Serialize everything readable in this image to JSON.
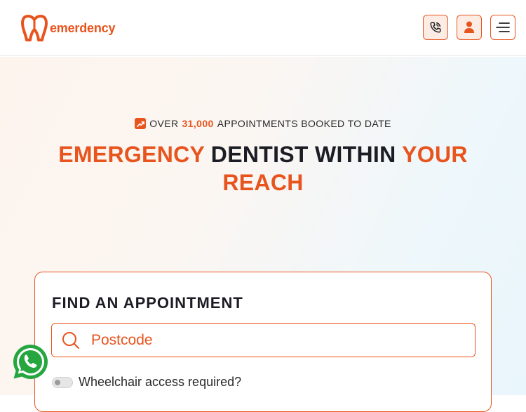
{
  "brand": {
    "name": "emerdency",
    "accent": "#e8541e"
  },
  "header": {
    "buttons": [
      {
        "icon": "phone-icon"
      },
      {
        "icon": "user-icon"
      },
      {
        "icon": "menu-icon"
      }
    ]
  },
  "hero": {
    "stat_prefix": "OVER",
    "stat_number": "31,000",
    "stat_suffix": "APPOINTMENTS BOOKED TO DATE",
    "headline_part1": "EMERGENCY",
    "headline_part2": "DENTIST WITHIN",
    "headline_part3": "YOUR",
    "headline_part4": "REACH"
  },
  "finder": {
    "title": "FIND AN APPOINTMENT",
    "search_placeholder": "Postcode",
    "search_value": "",
    "wheelchair_label": "Wheelchair access required?",
    "wheelchair_checked": false
  },
  "floating": {
    "icon": "whatsapp-icon"
  }
}
